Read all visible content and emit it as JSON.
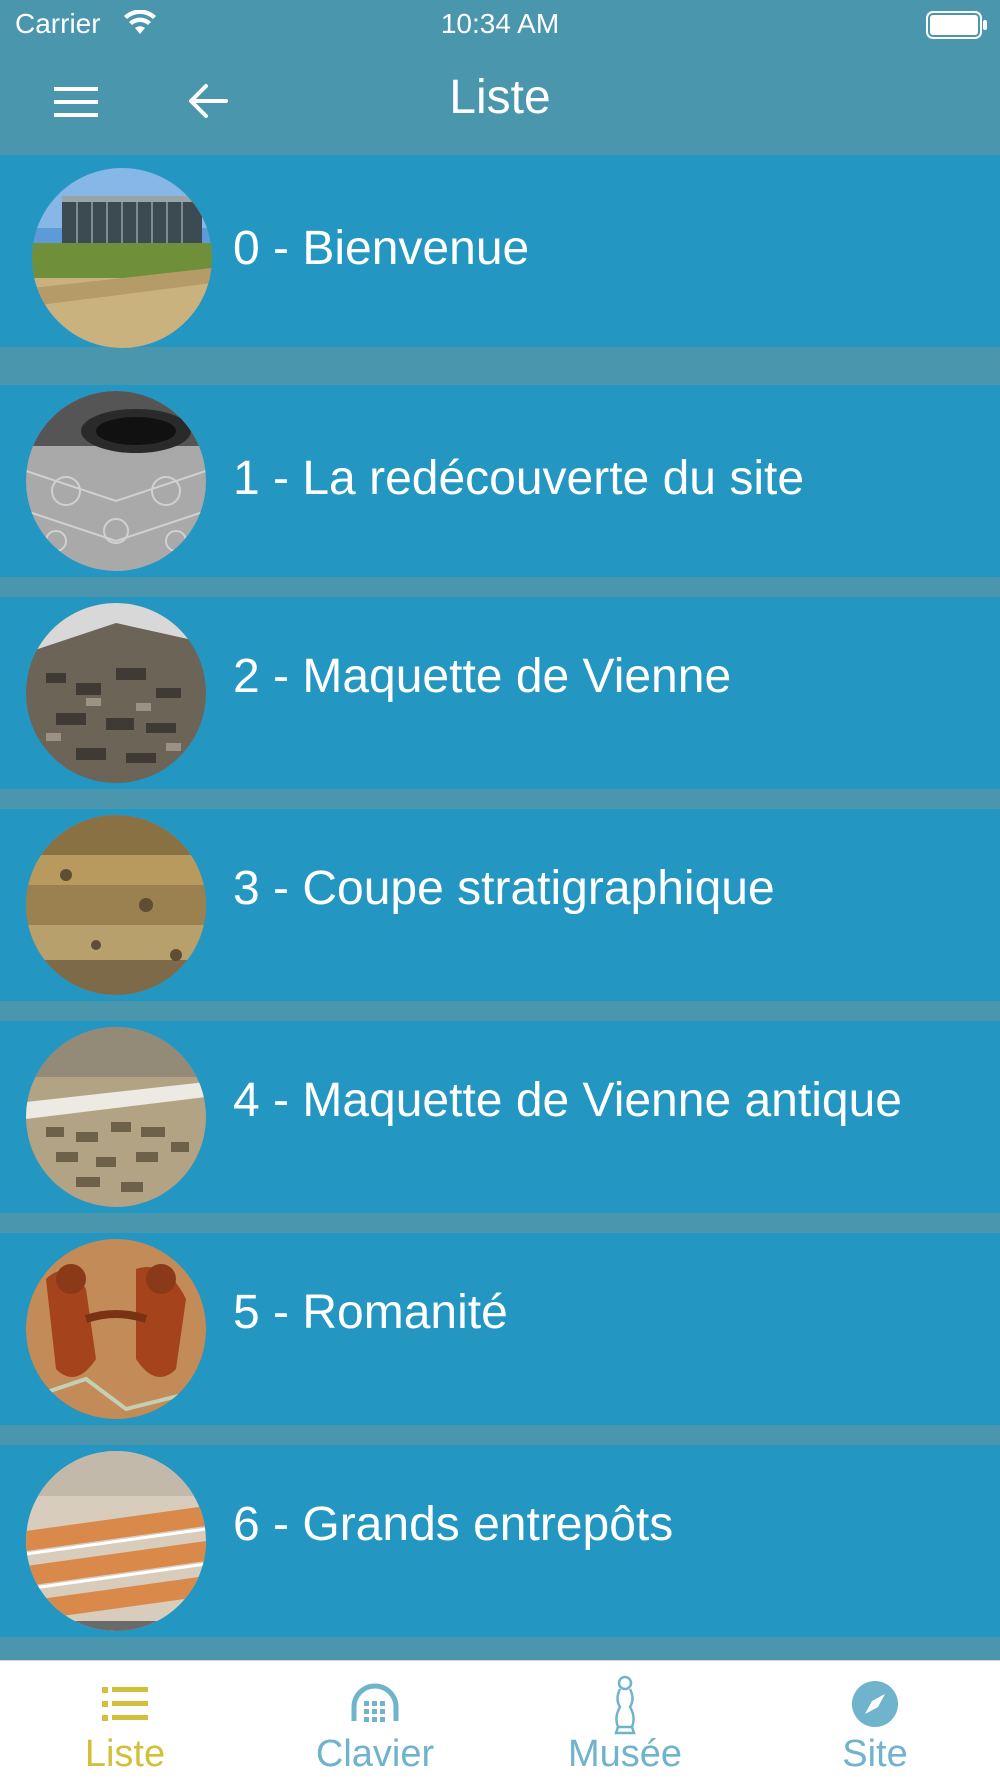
{
  "status": {
    "carrier": "Carrier",
    "time": "10:34 AM"
  },
  "header": {
    "title": "Liste"
  },
  "items": [
    {
      "label": "0 - Bienvenue"
    },
    {
      "label": "1 - La redécouverte du site"
    },
    {
      "label": "2 - Maquette de Vienne"
    },
    {
      "label": "3 - Coupe stratigraphique"
    },
    {
      "label": "4 - Maquette de Vienne antique"
    },
    {
      "label": "5 - Romanité"
    },
    {
      "label": "6 - Grands entrepôts"
    }
  ],
  "tabs": [
    {
      "label": "Liste",
      "icon": "list-icon",
      "active": true
    },
    {
      "label": "Clavier",
      "icon": "keypad-icon",
      "active": false
    },
    {
      "label": "Musée",
      "icon": "statue-icon",
      "active": false
    },
    {
      "label": "Site",
      "icon": "compass-icon",
      "active": false
    }
  ],
  "colors": {
    "header_bg": "#4a96ad",
    "item_bg": "#2496c2",
    "tab_active": "#d1c13a",
    "tab_inactive": "#6fb3cc"
  }
}
